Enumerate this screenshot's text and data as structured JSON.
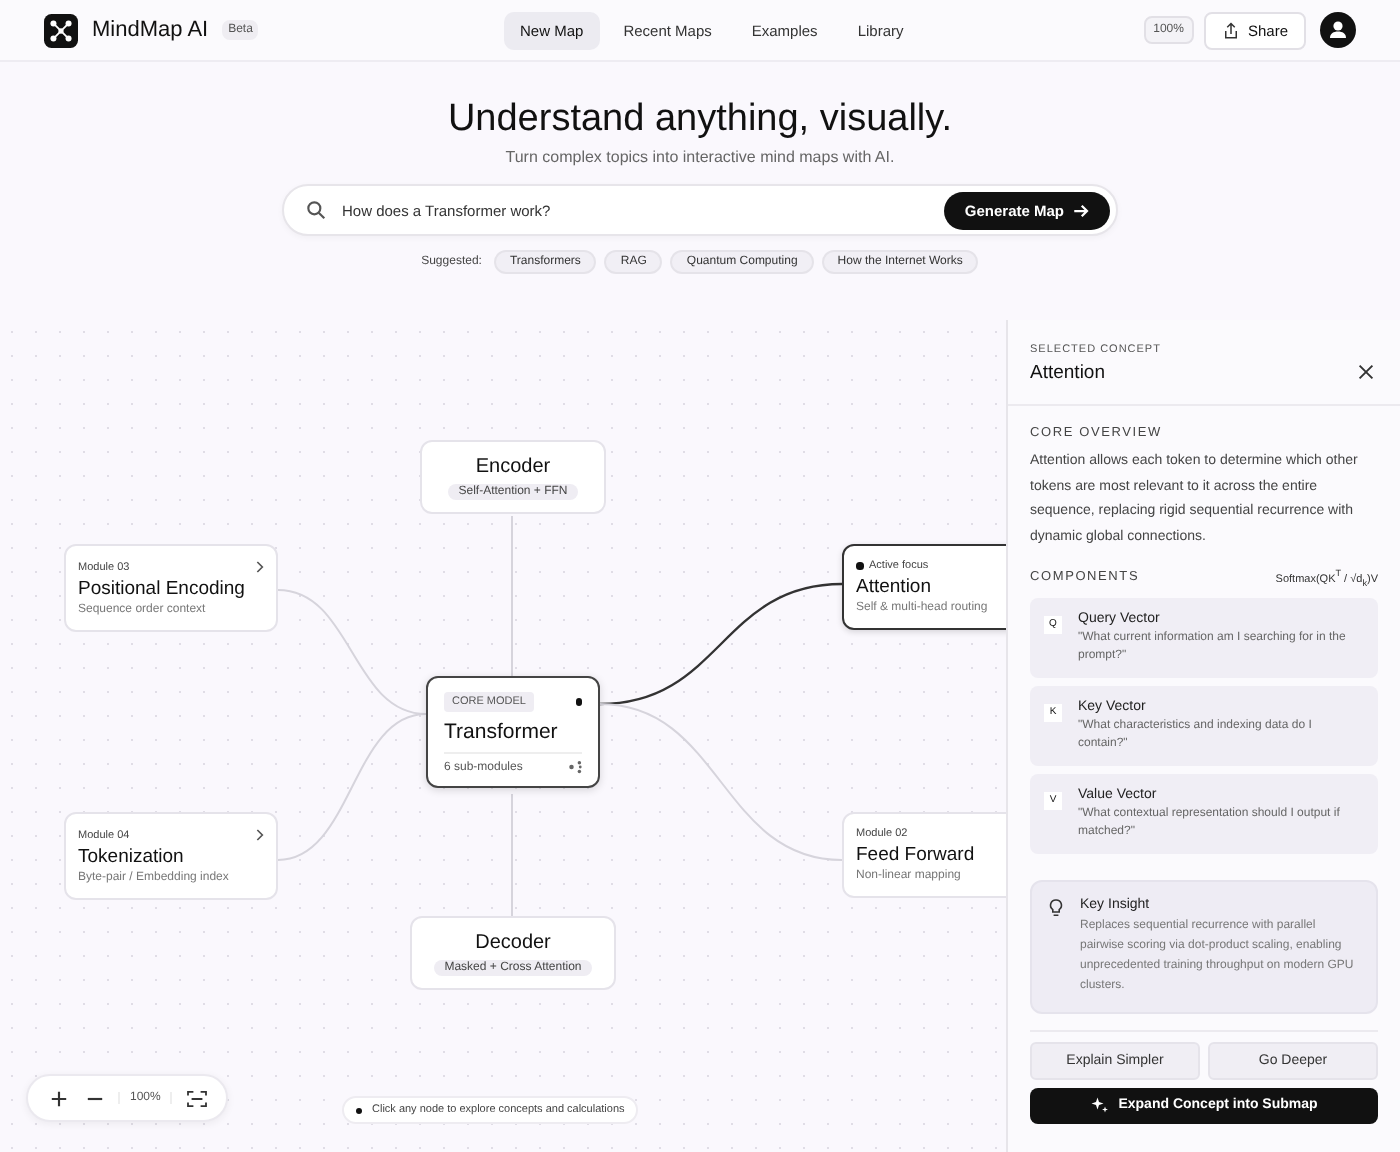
{
  "brand": {
    "name": "MindMap AI",
    "badge": "Beta"
  },
  "nav": [
    {
      "label": "New Map",
      "selected": true
    },
    {
      "label": "Recent Maps",
      "selected": false
    },
    {
      "label": "Examples",
      "selected": false
    },
    {
      "label": "Library",
      "selected": false
    }
  ],
  "zoom_badge": "100%",
  "share_button": "Share",
  "hero": {
    "title": "Understand anything, visually.",
    "subtitle": "Turn complex topics into interactive mind maps with AI.",
    "search_value": "How does a Transformer work?",
    "generate_button": "Generate Map",
    "suggested_label": "Suggested:",
    "suggestions": [
      "Transformers",
      "RAG",
      "Quantum Computing",
      "How the Internet Works"
    ]
  },
  "canvas": {
    "nodes": [
      {
        "kind": "layer",
        "title": "Encoder",
        "tag": "Self-Attention + FFN",
        "selected": false
      },
      {
        "kind": "module",
        "label": "Module 03",
        "title": "Positional Encoding",
        "subtitle": "Sequence order context",
        "selected": false
      },
      {
        "kind": "core",
        "tag": "CORE MODEL",
        "title": "Transformer",
        "footer": "6 sub-modules",
        "selected": false
      },
      {
        "kind": "module",
        "label": "Module 04",
        "title": "Tokenization",
        "subtitle": "Byte-pair / Embedding index",
        "selected": false
      },
      {
        "kind": "layer",
        "title": "Decoder",
        "tag": "Masked + Cross Attention",
        "selected": false
      },
      {
        "kind": "module",
        "label": "Active focus",
        "title": "Attention",
        "subtitle": "Self & multi-head routing",
        "selected": true
      },
      {
        "kind": "module",
        "label": "Module 02",
        "title": "Feed Forward",
        "subtitle": "Non-linear mapping",
        "selected": false
      }
    ],
    "zoom_level": "100%",
    "hint": "Click any node to explore concepts and calculations"
  },
  "panel": {
    "eyebrow": "SELECTED CONCEPT",
    "title": "Attention",
    "overview_heading": "CORE OVERVIEW",
    "overview": "Attention allows each token to determine which other tokens are most relevant to it across the entire sequence, replacing rigid sequential recurrence with dynamic global connections.",
    "components_heading": "COMPONENTS",
    "formula": "Softmax(QK$^{T}$ / √d$_{k}$)V",
    "components": [
      {
        "letter": "Q",
        "name": "Query Vector",
        "text": "\"What current information am I searching for in the prompt?\""
      },
      {
        "letter": "K",
        "name": "Key Vector",
        "text": "\"What characteristics and indexing data do I contain?\""
      },
      {
        "letter": "V",
        "name": "Value Vector",
        "text": "\"What contextual representation should I output if matched?\""
      }
    ],
    "insight": {
      "title": "Key Insight",
      "text": "Replaces sequential recurrence with parallel pairwise scoring via dot-product scaling, enabling unprecedented training throughput on modern GPU clusters."
    },
    "buttons": [
      "Explain Simpler",
      "Go Deeper"
    ],
    "expand_button": "Expand Concept into Submap"
  }
}
